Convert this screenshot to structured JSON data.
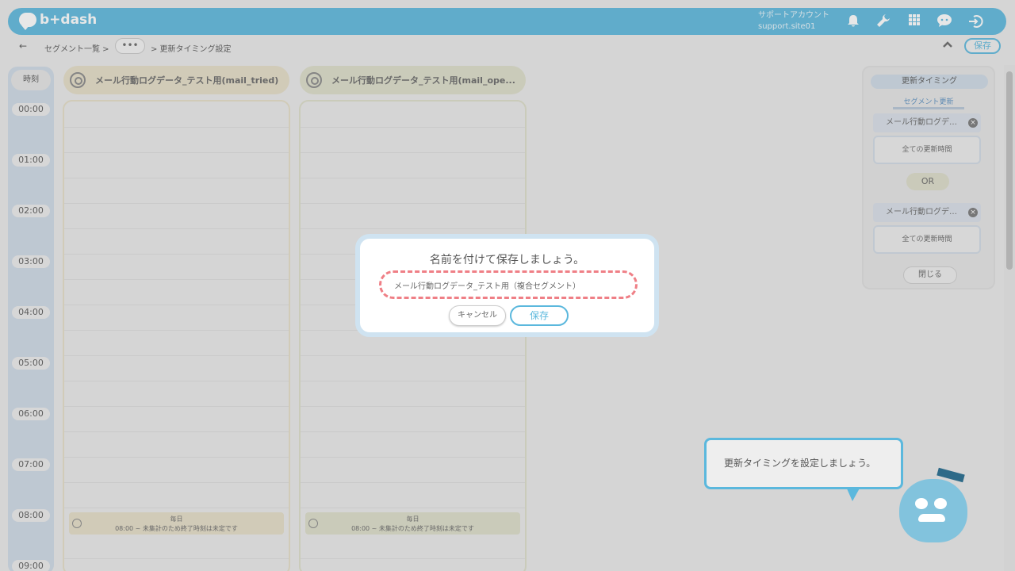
{
  "header": {
    "logo_text": "b+dash",
    "account_name": "サポートアカウント",
    "account_site": "support.site01",
    "icons": [
      "bell-icon",
      "wrench-icon",
      "grid-icon",
      "chat-icon",
      "logout-icon"
    ]
  },
  "breadcrumb": {
    "back": "←",
    "segment_list": "セグメント一覧 >",
    "dots": "•••",
    "current": "> 更新タイミング設定",
    "save_label": "保存"
  },
  "timeline": {
    "head_label": "時刻",
    "hours": [
      "00:00",
      "01:00",
      "02:00",
      "03:00",
      "04:00",
      "05:00",
      "06:00",
      "07:00",
      "08:00",
      "09:00"
    ]
  },
  "segments": [
    {
      "title": "メール行動ログデータ_テスト用(mail_tried)",
      "event_title": "毎日",
      "event_text": "08:00 ~ 未集計のため終了時刻は未定です"
    },
    {
      "title": "メール行動ログデータ_テスト用(mail_ope...",
      "event_title": "毎日",
      "event_text": "08:00 ~ 未集計のため終了時刻は未定です"
    }
  ],
  "right_panel": {
    "title": "更新タイミング",
    "subtitle": "セグメント更新",
    "items": [
      {
        "label": "メール行動ログデ…",
        "all_label": "全ての更新時間"
      },
      {
        "label": "メール行動ログデ…",
        "all_label": "全ての更新時間"
      }
    ],
    "or_label": "OR",
    "close_label": "閉じる"
  },
  "modal": {
    "title": "名前を付けて保存しましょう。",
    "input_value": "メール行動ログデータ_テスト用（複合セグメント）",
    "cancel_label": "キャンセル",
    "save_label": "保存"
  },
  "hint": {
    "text": "更新タイミングを設定しましょう。"
  },
  "colors": {
    "accent": "#5bb8dd",
    "dashed_border": "#ef7f86"
  }
}
